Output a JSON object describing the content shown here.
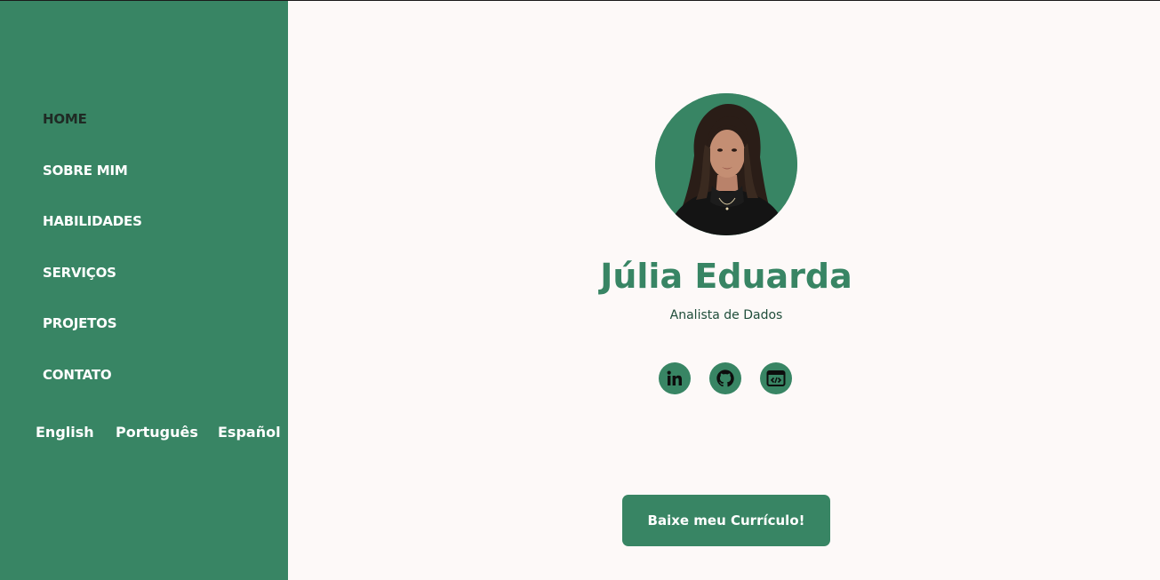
{
  "nav": {
    "items": [
      {
        "label": "HOME",
        "active": true
      },
      {
        "label": "SOBRE MIM",
        "active": false
      },
      {
        "label": "HABILIDADES",
        "active": false
      },
      {
        "label": "SERVIÇOS",
        "active": false
      },
      {
        "label": "PROJETOS",
        "active": false
      },
      {
        "label": "CONTATO",
        "active": false
      }
    ]
  },
  "languages": [
    "English",
    "Português",
    "Español"
  ],
  "profile": {
    "name": "Júlia Eduarda",
    "role": "Analista de Dados"
  },
  "social": [
    {
      "icon": "linkedin-icon"
    },
    {
      "icon": "github-icon"
    },
    {
      "icon": "code-window-icon"
    }
  ],
  "cv_button": {
    "label": "Baixe meu Currículo!"
  },
  "colors": {
    "accent": "#388564",
    "background": "#fdf9f8",
    "active_nav": "#1f2a24",
    "role_text": "#1f4d3a"
  }
}
